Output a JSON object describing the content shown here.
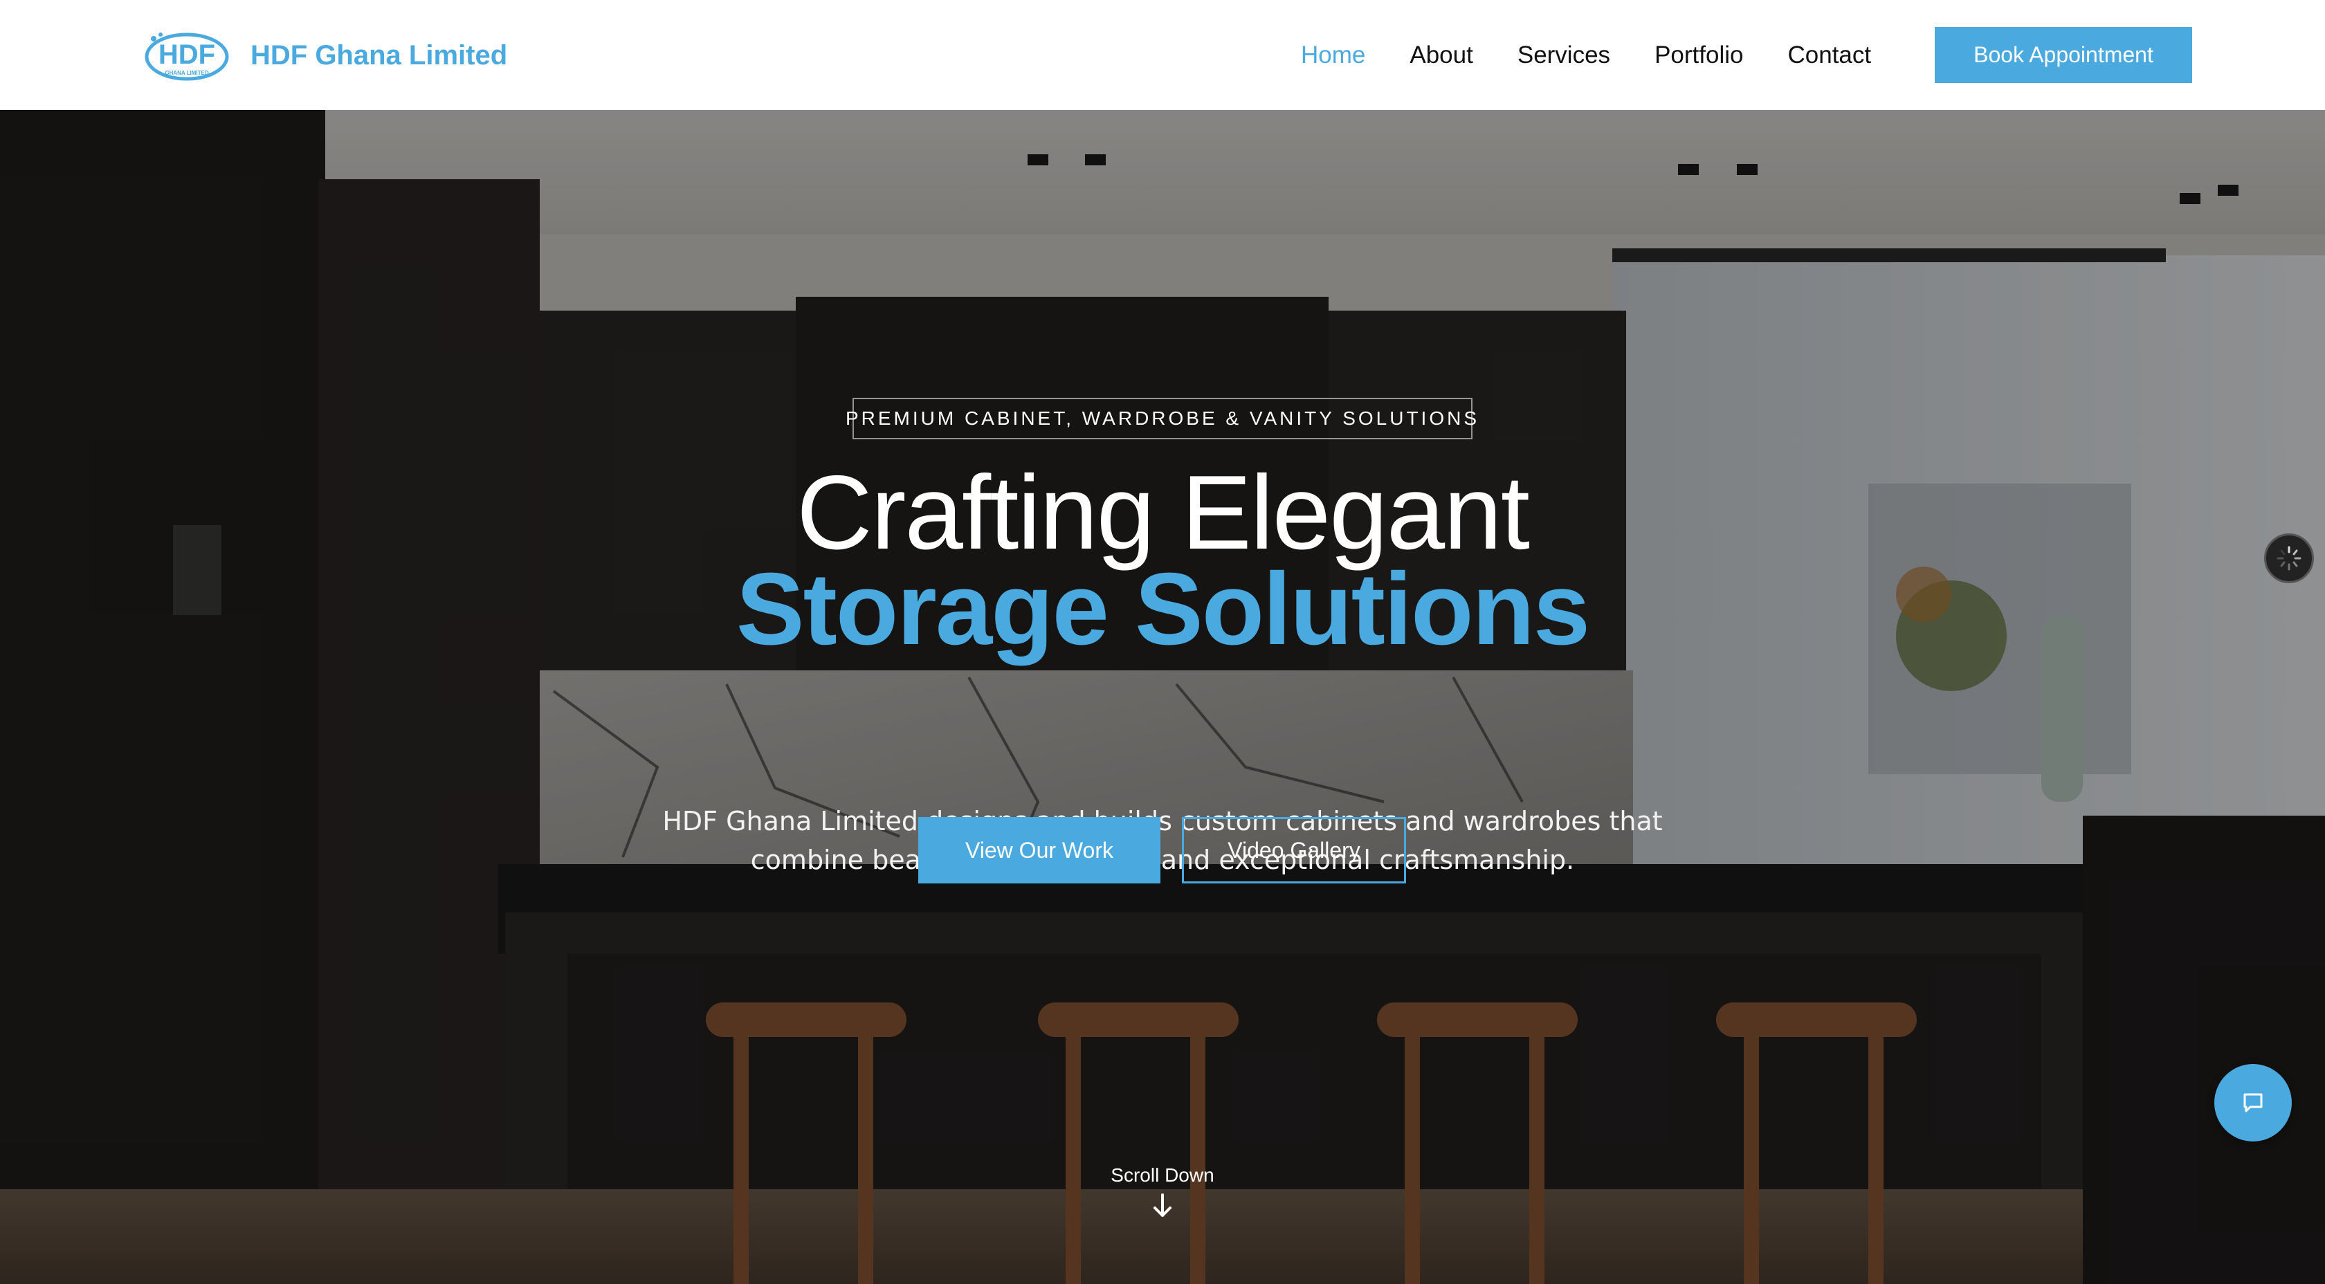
{
  "brand": {
    "name": "HDF Ghana Limited",
    "logo_text": "HDF",
    "logo_subtext": "GHANA LIMITED"
  },
  "nav": {
    "items": [
      {
        "label": "Home",
        "active": true
      },
      {
        "label": "About",
        "active": false
      },
      {
        "label": "Services",
        "active": false
      },
      {
        "label": "Portfolio",
        "active": false
      },
      {
        "label": "Contact",
        "active": false
      }
    ],
    "cta": "Book Appointment"
  },
  "hero": {
    "tagline": "PREMIUM CABINET, WARDROBE & VANITY SOLUTIONS",
    "title_line1": "Crafting Elegant",
    "title_line2": "Storage Solutions",
    "description": "HDF Ghana Limited designs and builds custom cabinets and wardrobes that combine beauty, functionality, and exceptional craftsmanship.",
    "primary_button": "View Our Work",
    "secondary_button": "Video Gallery",
    "scroll_label": "Scroll Down"
  },
  "icons": {
    "scroll": "arrow-down-icon",
    "chat": "chat-bubble-icon",
    "loader": "spinner-icon",
    "logo": "hdf-logo-icon"
  },
  "colors": {
    "accent": "#4aa9de",
    "nav_bg": "#ffffff",
    "text_dark": "#111111",
    "overlay": "#000000"
  }
}
